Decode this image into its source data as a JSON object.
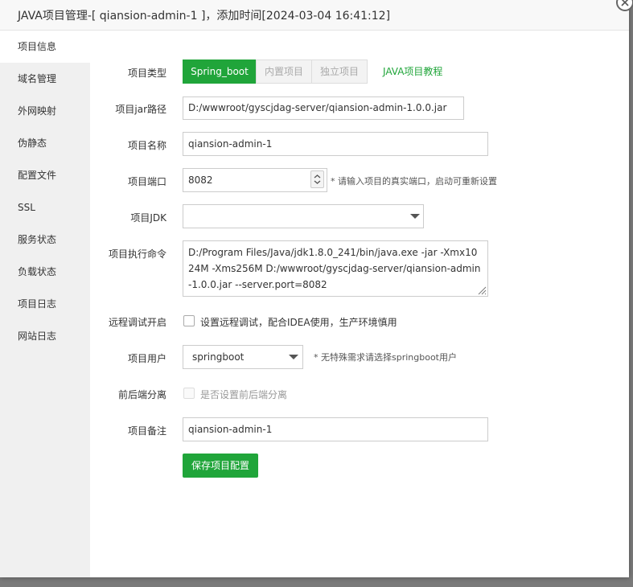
{
  "window": {
    "title": "JAVA项目管理-[ qiansion-admin-1 ]，添加时间[2024-03-04 16:41:12]"
  },
  "sidebar": {
    "items": [
      {
        "label": "项目信息",
        "active": true
      },
      {
        "label": "域名管理"
      },
      {
        "label": "外网映射"
      },
      {
        "label": "伪静态"
      },
      {
        "label": "配置文件"
      },
      {
        "label": "SSL"
      },
      {
        "label": "服务状态"
      },
      {
        "label": "负载状态"
      },
      {
        "label": "项目日志"
      },
      {
        "label": "网站日志"
      }
    ]
  },
  "form": {
    "project_type": {
      "label": "项目类型",
      "options": [
        "Spring_boot",
        "内置项目",
        "独立项目"
      ],
      "selected": "Spring_boot",
      "tutorial_link": "JAVA项目教程"
    },
    "jar_path": {
      "label": "项目jar路径",
      "value": "D:/wwwroot/gyscjdag-server/qiansion-admin-1.0.0.jar"
    },
    "project_name": {
      "label": "项目名称",
      "value": "qiansion-admin-1"
    },
    "port": {
      "label": "项目端口",
      "value": "8082",
      "hint": "* 请输入项目的真实端口，启动可重新设置"
    },
    "jdk": {
      "label": "项目JDK",
      "value": ""
    },
    "command": {
      "label": "项目执行命令",
      "value": "D:/Program Files/Java/jdk1.8.0_241/bin/java.exe -jar -Xmx1024M -Xms256M D:/wwwroot/gyscjdag-server/qiansion-admin-1.0.0.jar --server.port=8082"
    },
    "remote_debug": {
      "label": "远程调试开启",
      "checkbox_label": "设置远程调试，配合IDEA使用，生产环境慎用",
      "checked": false
    },
    "user": {
      "label": "项目用户",
      "value": "springboot",
      "hint": "* 无特殊需求请选择springboot用户"
    },
    "separation": {
      "label": "前后端分离",
      "checkbox_label": "是否设置前后端分离",
      "checked": false
    },
    "remark": {
      "label": "项目备注",
      "value": "qiansion-admin-1"
    },
    "save_label": "保存项目配置"
  },
  "colors": {
    "accent": "#20a53a",
    "sidebar_bg": "#f0f0f0",
    "titlebar_bg": "#f8f8f8"
  }
}
